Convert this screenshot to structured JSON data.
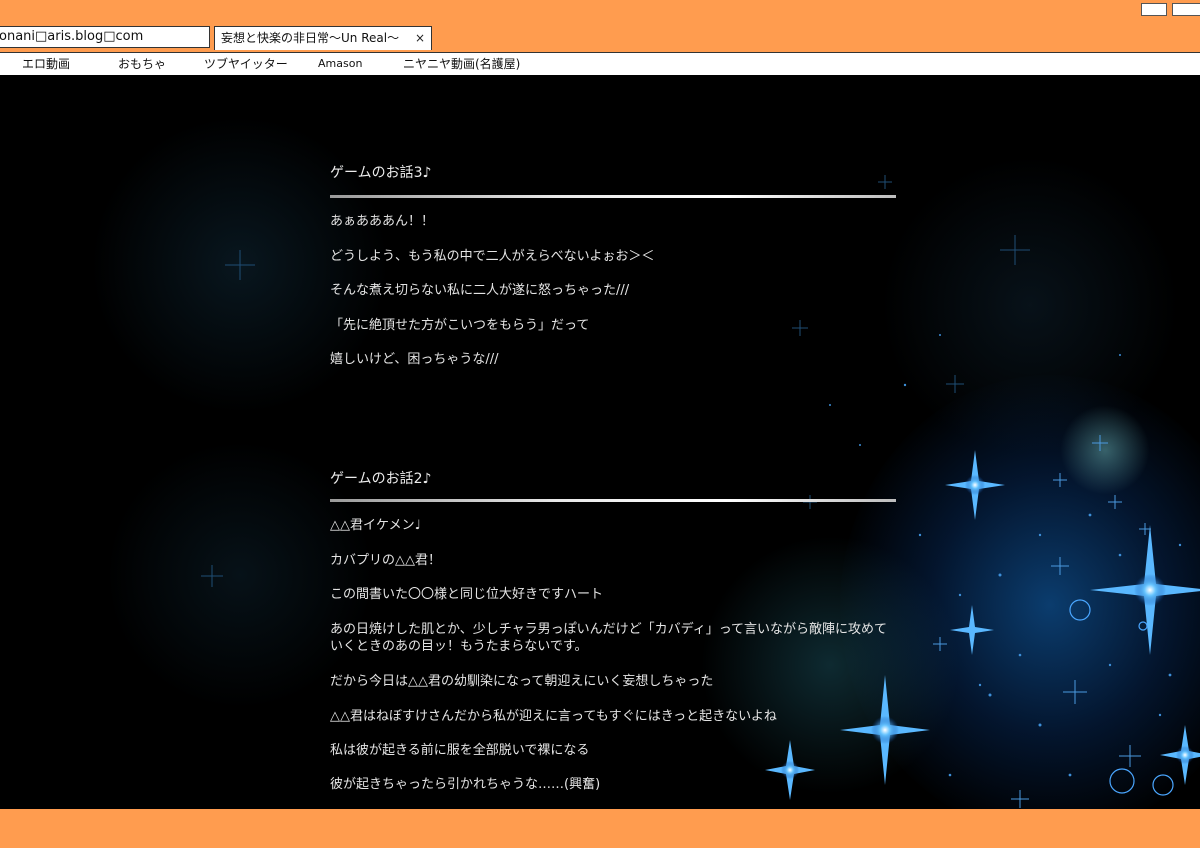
{
  "browser": {
    "address": "onani□aris.blog□com",
    "tab_title": "妄想と快楽の非日常〜Un Real〜",
    "tab_close": "×"
  },
  "bookmarks": [
    "エロ動画",
    "おもちゃ",
    "ツブヤイッター",
    "Amason",
    "ニヤニヤ動画(名護屋)"
  ],
  "posts": [
    {
      "title": "ゲームのお話3♪",
      "lines": [
        " あぁあああん！！",
        "どうしよう、もう私の中で二人がえらべないよぉお＞＜",
        "そんな煮え切らない私に二人が遂に怒っちゃった///",
        "「先に絶頂せた方がこいつをもらう」だって",
        "嬉しいけど、困っちゃうな///"
      ]
    },
    {
      "title": "ゲームのお話2♪",
      "lines": [
        "  △△君イケメン♩",
        "カバプリの△△君！",
        "この間書いた〇〇様と同じ位大好きですハート",
        "あの日焼けした肌とか、少しチャラ男っぽいんだけど「カバディ」って言いながら敵陣に攻めていくときのあの目ッ！もうたまらないです。",
        "だから今日は△△君の幼馴染になって朝迎えにいく妄想しちゃった",
        "△△君はねぼすけさんだから私が迎えに言ってもすぐにはきっと起きないよね",
        "私は彼が起きる前に服を全部脱いで裸になる",
        "彼が起きちゃったら引かれちゃうな……(興奮)"
      ]
    }
  ]
}
